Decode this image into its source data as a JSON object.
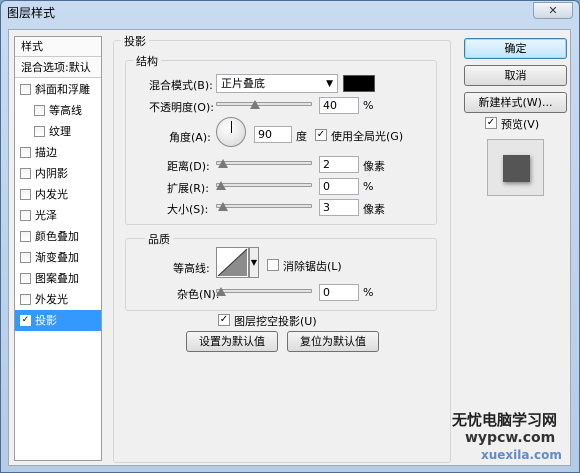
{
  "window": {
    "title": "图层样式",
    "close_glyph": "✕"
  },
  "sidebar": {
    "header": "样式",
    "subheader": "混合选项:默认",
    "items": [
      {
        "label": "斜面和浮雕",
        "checked": false,
        "sub": false,
        "selected": false
      },
      {
        "label": "等高线",
        "checked": false,
        "sub": true,
        "selected": false
      },
      {
        "label": "纹理",
        "checked": false,
        "sub": true,
        "selected": false
      },
      {
        "label": "描边",
        "checked": false,
        "sub": false,
        "selected": false
      },
      {
        "label": "内阴影",
        "checked": false,
        "sub": false,
        "selected": false
      },
      {
        "label": "内发光",
        "checked": false,
        "sub": false,
        "selected": false
      },
      {
        "label": "光泽",
        "checked": false,
        "sub": false,
        "selected": false
      },
      {
        "label": "颜色叠加",
        "checked": false,
        "sub": false,
        "selected": false
      },
      {
        "label": "渐变叠加",
        "checked": false,
        "sub": false,
        "selected": false
      },
      {
        "label": "图案叠加",
        "checked": false,
        "sub": false,
        "selected": false
      },
      {
        "label": "外发光",
        "checked": false,
        "sub": false,
        "selected": false
      },
      {
        "label": "投影",
        "checked": true,
        "sub": false,
        "selected": true
      }
    ]
  },
  "panel": {
    "title": "投影",
    "structure": {
      "title": "结构",
      "blend_mode": {
        "label": "混合模式(B):",
        "value": "正片叠底",
        "color": "#000000"
      },
      "opacity": {
        "label": "不透明度(O):",
        "value": "40",
        "unit": "%",
        "slider_level": 0.4
      },
      "angle": {
        "label": "角度(A):",
        "value": "90",
        "unit": "度",
        "global_light_label": "使用全局光(G)",
        "global_light_checked": true
      },
      "distance": {
        "label": "距离(D):",
        "value": "2",
        "unit": "像素",
        "slider_level": 0.02
      },
      "spread": {
        "label": "扩展(R):",
        "value": "0",
        "unit": "%",
        "slider_level": 0.0
      },
      "size": {
        "label": "大小(S):",
        "value": "3",
        "unit": "像素",
        "slider_level": 0.02
      }
    },
    "quality": {
      "title": "品质",
      "contour_label": "等高线:",
      "antialias_label": "消除锯齿(L)",
      "antialias_checked": false,
      "noise": {
        "label": "杂色(N):",
        "value": "0",
        "unit": "%",
        "slider_level": 0.0
      }
    },
    "knockout_label": "图层挖空投影(U)",
    "knockout_checked": true,
    "set_default_label": "设置为默认值",
    "reset_default_label": "复位为默认值"
  },
  "buttons": {
    "ok": "确定",
    "cancel": "取消",
    "new_style": "新建样式(W)...",
    "preview_label": "预览(V)",
    "preview_checked": true
  },
  "watermark": {
    "line1": "无忧电脑学习网",
    "line2": "wypcw.com",
    "line3": "xuexila.com"
  }
}
